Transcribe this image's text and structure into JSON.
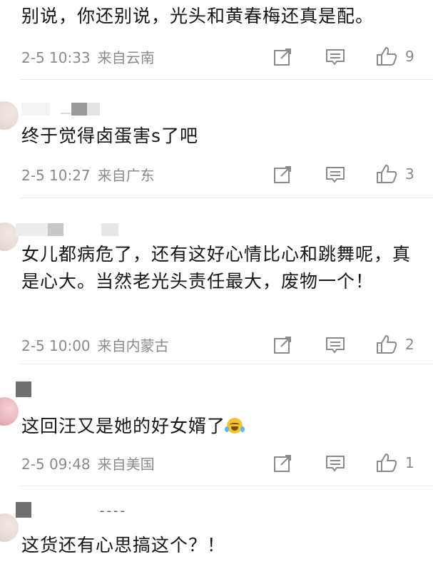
{
  "comments": [
    {
      "text": "别说，你还别说，光头和黄春梅还真是配。",
      "time": "2-5 10:33",
      "location": "来自云南",
      "share_icon": "share-icon",
      "reply_icon": "reply-icon",
      "like_icon": "like-icon",
      "like_count": "9"
    },
    {
      "text": "终于觉得卤蛋害s了吧",
      "time": "2-5 10:27",
      "location": "来自广东",
      "share_icon": "share-icon",
      "reply_icon": "reply-icon",
      "like_icon": "like-icon",
      "like_count": "3"
    },
    {
      "text": "女儿都病危了，还有这好心情比心和跳舞呢，真是心大。当然老光头责任最大，废物一个！",
      "time": "2-5 10:00",
      "location": "来自内蒙古",
      "share_icon": "share-icon",
      "reply_icon": "reply-icon",
      "like_icon": "like-icon",
      "like_count": "2"
    },
    {
      "text": "这回汪又是她的好女婿了",
      "emoji": "laughing-tears-emoji",
      "time": "2-5 09:48",
      "location": "来自美国",
      "share_icon": "share-icon",
      "reply_icon": "reply-icon",
      "like_icon": "like-icon",
      "like_count": "1"
    },
    {
      "name_partial": "----",
      "text": "这货还有心思搞这个？！",
      "share_icon": "share-icon",
      "reply_icon": "reply-icon",
      "like_icon": "like-icon"
    }
  ],
  "colors": {
    "text": "#161616",
    "meta": "#8a8a8a",
    "icon": "#8a8a8a",
    "divider": "#ececec"
  }
}
